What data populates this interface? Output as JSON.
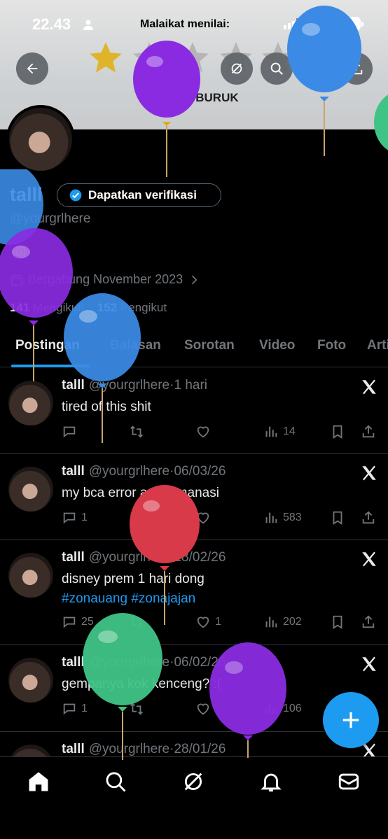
{
  "status_bar": {
    "time": "22.43",
    "network": "4G",
    "battery": "91"
  },
  "rating_overlay": {
    "title": "Malaikat menilai:",
    "label": "SANGAT BURUK",
    "stars_filled": 1,
    "stars_total": 5
  },
  "header_buttons": [
    "back-icon",
    "grok-icon",
    "search-icon",
    "edit-icon",
    "share-icon"
  ],
  "profile": {
    "name": "talll",
    "verify_label": "Dapatkan verifikasi",
    "handle": "@yourgrlhere",
    "joined": "Bergabung November 2023",
    "following_count": "141",
    "following_label": "Mengikuti",
    "followers_count": "152",
    "followers_label": "Pengikut"
  },
  "tabs": [
    {
      "label": "Postingan",
      "active": true
    },
    {
      "label": "Balasan",
      "active": false
    },
    {
      "label": "Sorotan",
      "active": false
    },
    {
      "label": "Video",
      "active": false
    },
    {
      "label": "Foto",
      "active": false
    },
    {
      "label": "Artikel",
      "active": false
    }
  ],
  "posts": [
    {
      "name": "talll",
      "handle": "@yourgrlhere",
      "time": "1 hari",
      "text": "tired of this shit",
      "hashtags": "",
      "replies": "",
      "retweets": "",
      "likes": "",
      "views": "14"
    },
    {
      "name": "talll",
      "handle": "@yourgrlhere",
      "time": "06/03/26",
      "text": "my bca error apa gimanasi",
      "hashtags": "",
      "replies": "1",
      "retweets": "",
      "likes": "",
      "views": "583"
    },
    {
      "name": "talll",
      "handle": "@yourgrlhere",
      "time": "18/02/26",
      "text": "disney prem 1 hari dong",
      "hashtags": "#zonauang #zonajajan",
      "replies": "25",
      "retweets": "",
      "likes": "1",
      "views": "202"
    },
    {
      "name": "talll",
      "handle": "@yourgrlhere",
      "time": "06/02/26",
      "text": "gempanya kok kenceng? :(",
      "hashtags": "",
      "replies": "1",
      "retweets": "",
      "likes": "",
      "views": "106"
    },
    {
      "name": "talll",
      "handle": "@yourgrlhere",
      "time": "28/01/26",
      "text": "",
      "hashtags": "",
      "replies": "",
      "retweets": "",
      "likes": "",
      "views": ""
    }
  ],
  "bottom_nav": [
    "home-icon",
    "search-icon",
    "grok-icon",
    "notifications-icon",
    "messages-icon"
  ],
  "colors": {
    "accent": "#1d9bf0",
    "background": "#000000",
    "muted": "#71767b",
    "star": "#e0b42a"
  }
}
